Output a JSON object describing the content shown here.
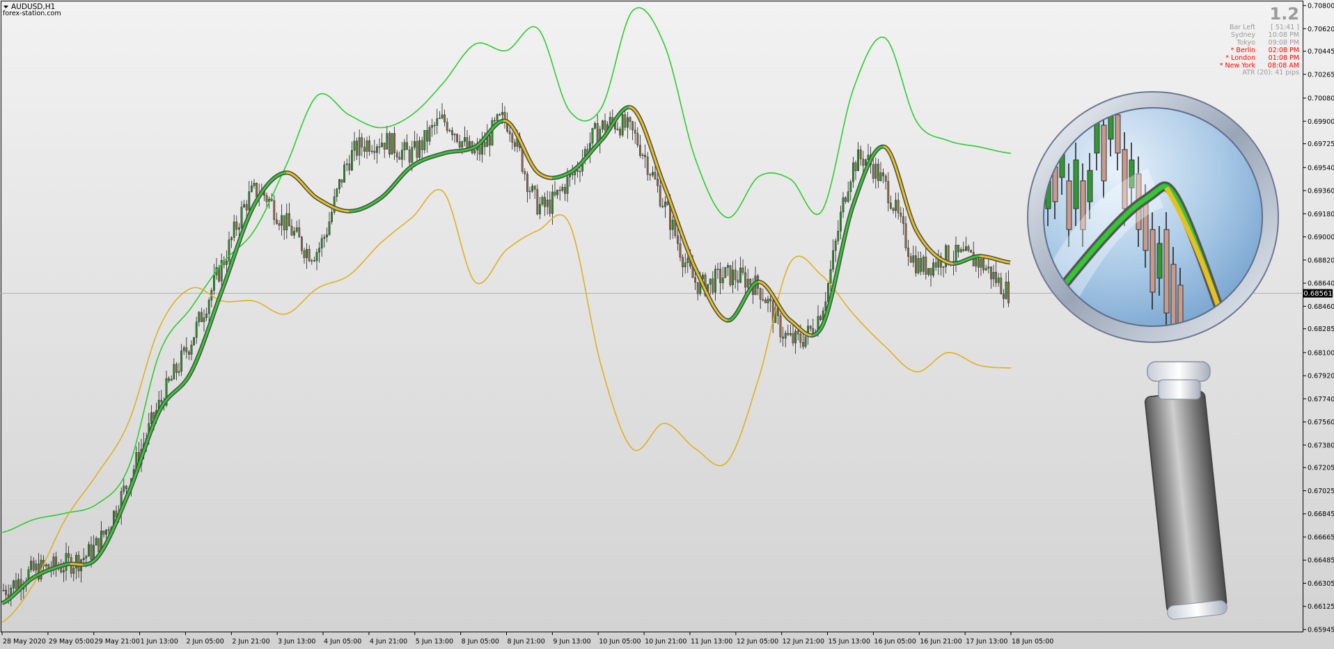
{
  "window": {
    "symbol_label": "AUDUSD,H1",
    "watermark": "forex-station.com",
    "version": "1.2"
  },
  "info_panel": [
    {
      "label": "Bar Left",
      "value": "[ 51:41 ]",
      "color": "#9a9a9a"
    },
    {
      "label": "Sydney",
      "value": "10:08 PM",
      "color": "#9a9a9a"
    },
    {
      "label": "Tokyo",
      "value": "09:08 PM",
      "color": "#9a9a9a"
    },
    {
      "label": "* Berlin",
      "value": "02:08 PM",
      "color": "#ff0000"
    },
    {
      "label": "* London",
      "value": "01:08 PM",
      "color": "#ff0000"
    },
    {
      "label": "* New York",
      "value": "08:08 AM",
      "color": "#ff0000"
    }
  ],
  "atr_text": "ATR (20): 41 pips",
  "current_price": "0.68561",
  "colors": {
    "bg_top": "#f2f2f2",
    "bg_bottom": "#d2d2d2",
    "upper_band": "#2ecc2e",
    "lower_band": "#e0b020",
    "ma_inner_up": "#32c832",
    "ma_inner_down": "#e6c020",
    "ma_outline": "#4a4a4a",
    "candle_bull": "#2d8a2d",
    "candle_bear": "#8a6a4a",
    "price_line": "#b0b0b0",
    "axis_text": "#000000"
  },
  "chart_data": {
    "type": "line",
    "title": "AUDUSD,H1",
    "xlabel": "",
    "ylabel": "",
    "ylim": [
      0.65945,
      0.708
    ],
    "y_ticks": [
      "0.70800",
      "0.70620",
      "0.70445",
      "0.70265",
      "0.70080",
      "0.69900",
      "0.69725",
      "0.69540",
      "0.69360",
      "0.69180",
      "0.69000",
      "0.68820",
      "0.68640",
      "0.68460",
      "0.68285",
      "0.68100",
      "0.67920",
      "0.67740",
      "0.67560",
      "0.67380",
      "0.67205",
      "0.67025",
      "0.66845",
      "0.66665",
      "0.66485",
      "0.66305",
      "0.66125",
      "0.65945"
    ],
    "x_ticks": [
      "28 May 2020",
      "29 May 05:00",
      "29 May 21:00",
      "1 Jun 13:00",
      "2 Jun 05:00",
      "2 Jun 21:00",
      "3 Jun 13:00",
      "4 Jun 05:00",
      "4 Jun 21:00",
      "5 Jun 13:00",
      "8 Jun 05:00",
      "8 Jun 21:00",
      "9 Jun 13:00",
      "10 Jun 05:00",
      "10 Jun 21:00",
      "11 Jun 13:00",
      "12 Jun 05:00",
      "12 Jun 21:00",
      "15 Jun 13:00",
      "16 Jun 05:00",
      "16 Jun 21:00",
      "17 Jun 13:00",
      "18 Jun 05:00"
    ],
    "series": [
      {
        "role": "upper-band",
        "values": [
          0.667,
          0.668,
          0.6685,
          0.6692,
          0.672,
          0.681,
          0.6845,
          0.688,
          0.6905,
          0.6955,
          0.701,
          0.6995,
          0.6985,
          0.6995,
          0.702,
          0.705,
          0.7045,
          0.7062,
          0.6998,
          0.7,
          0.7076,
          0.705,
          0.696,
          0.6915,
          0.6947,
          0.6945,
          0.692,
          0.7015,
          0.7055,
          0.699,
          0.6975,
          0.697,
          0.6965
        ]
      },
      {
        "role": "lower-band",
        "values": [
          0.66,
          0.663,
          0.668,
          0.6715,
          0.6755,
          0.683,
          0.686,
          0.685,
          0.685,
          0.684,
          0.686,
          0.687,
          0.6895,
          0.6915,
          0.6935,
          0.6865,
          0.689,
          0.6905,
          0.691,
          0.68,
          0.6735,
          0.6755,
          0.6735,
          0.6725,
          0.679,
          0.688,
          0.687,
          0.684,
          0.6815,
          0.6795,
          0.681,
          0.68,
          0.6798
        ]
      },
      {
        "role": "moving-average",
        "values": [
          0.6615,
          0.6635,
          0.6645,
          0.665,
          0.67,
          0.6765,
          0.6795,
          0.686,
          0.6925,
          0.695,
          0.693,
          0.692,
          0.693,
          0.6955,
          0.6965,
          0.697,
          0.699,
          0.695,
          0.695,
          0.6975,
          0.7,
          0.694,
          0.6875,
          0.6835,
          0.6865,
          0.6835,
          0.683,
          0.6925,
          0.697,
          0.6905,
          0.688,
          0.6885,
          0.688
        ]
      },
      {
        "role": "price-close",
        "values": [
          0.6625,
          0.664,
          0.6645,
          0.666,
          0.671,
          0.677,
          0.682,
          0.688,
          0.6935,
          0.691,
          0.689,
          0.696,
          0.6975,
          0.6965,
          0.699,
          0.6965,
          0.699,
          0.6925,
          0.6945,
          0.6985,
          0.698,
          0.6925,
          0.6865,
          0.687,
          0.686,
          0.682,
          0.6845,
          0.6955,
          0.694,
          0.688,
          0.6885,
          0.688,
          0.6856
        ]
      }
    ],
    "grid": false,
    "legend": "none"
  }
}
